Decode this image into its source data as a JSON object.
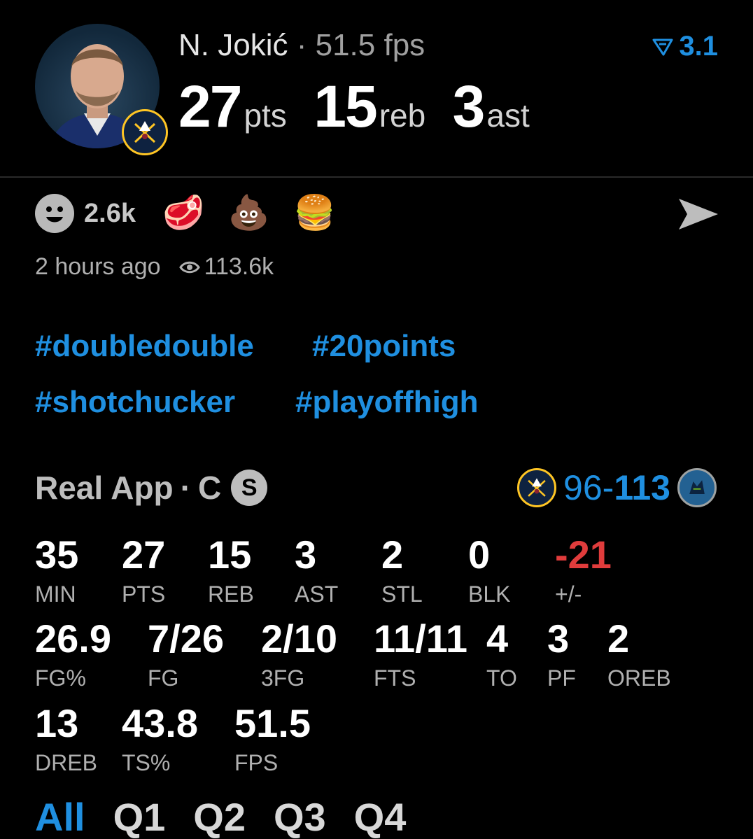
{
  "header": {
    "player_name": "N. Jokić",
    "separator": "·",
    "fps_label": "51.5 fps",
    "rating": "3.1",
    "stats": [
      {
        "value": "27",
        "unit": "pts"
      },
      {
        "value": "15",
        "unit": "reb"
      },
      {
        "value": "3",
        "unit": "ast"
      }
    ]
  },
  "reactions": {
    "count": "2.6k",
    "emojis": [
      "🥩",
      "💩",
      "🍔"
    ],
    "time_ago": "2 hours ago",
    "views": "113.6k"
  },
  "tags": [
    "#doubledouble",
    "#20points",
    "#shotchucker",
    "#playoffhigh"
  ],
  "source": {
    "label": "Real App",
    "separator": "·",
    "position": "C",
    "badge": "S"
  },
  "game": {
    "score_home": "96",
    "score_dash": "-",
    "score_away": "113"
  },
  "stat_rows": [
    [
      {
        "value": "35",
        "label": "MIN"
      },
      {
        "value": "27",
        "label": "PTS"
      },
      {
        "value": "15",
        "label": "REB"
      },
      {
        "value": "3",
        "label": "AST"
      },
      {
        "value": "2",
        "label": "STL"
      },
      {
        "value": "0",
        "label": "BLK"
      },
      {
        "value": "-21",
        "label": "+/-",
        "negative": true
      }
    ],
    [
      {
        "value": "26.9",
        "label": "FG%"
      },
      {
        "value": "7/26",
        "label": "FG"
      },
      {
        "value": "2/10",
        "label": "3FG"
      },
      {
        "value": "11/11",
        "label": "FTS"
      },
      {
        "value": "4",
        "label": "TO"
      },
      {
        "value": "3",
        "label": "PF"
      },
      {
        "value": "2",
        "label": "OREB"
      }
    ],
    [
      {
        "value": "13",
        "label": "DREB"
      },
      {
        "value": "43.8",
        "label": "TS%"
      },
      {
        "value": "51.5",
        "label": "FPS"
      }
    ]
  ],
  "tabs": [
    "All",
    "Q1",
    "Q2",
    "Q3",
    "Q4"
  ],
  "colors": {
    "accent": "#1f8fe0",
    "negative": "#e03c3c",
    "nuggets_gold": "#fec524",
    "nuggets_navy": "#0e2240",
    "wolves_blue": "#236192"
  }
}
